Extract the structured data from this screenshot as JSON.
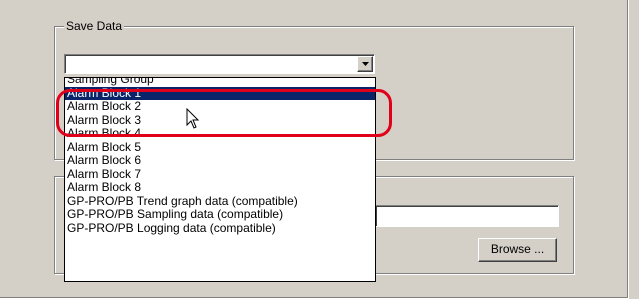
{
  "save_data": {
    "group_label": "Save Data",
    "combo_value": "",
    "options": [
      "Sampling Group",
      "Alarm Block 1",
      "Alarm Block 2",
      "Alarm Block 3",
      "Alarm Block 4",
      "Alarm Block 5",
      "Alarm Block 6",
      "Alarm Block 7",
      "Alarm Block 8",
      "GP-PRO/PB Trend graph data (compatible)",
      "GP-PRO/PB Sampling data (compatible)",
      "GP-PRO/PB Logging data (compatible)"
    ],
    "selected_option": "Alarm Block 1"
  },
  "file_section": {
    "path_value": "",
    "browse_label": "Browse ..."
  },
  "icons": {
    "dropdown_arrow": "chevron-down-icon",
    "pointer": "mouse-pointer-icon"
  },
  "colors": {
    "highlight": "#e0001a",
    "selection": "#0a246a",
    "dialog_bg": "#d4d0c8"
  }
}
